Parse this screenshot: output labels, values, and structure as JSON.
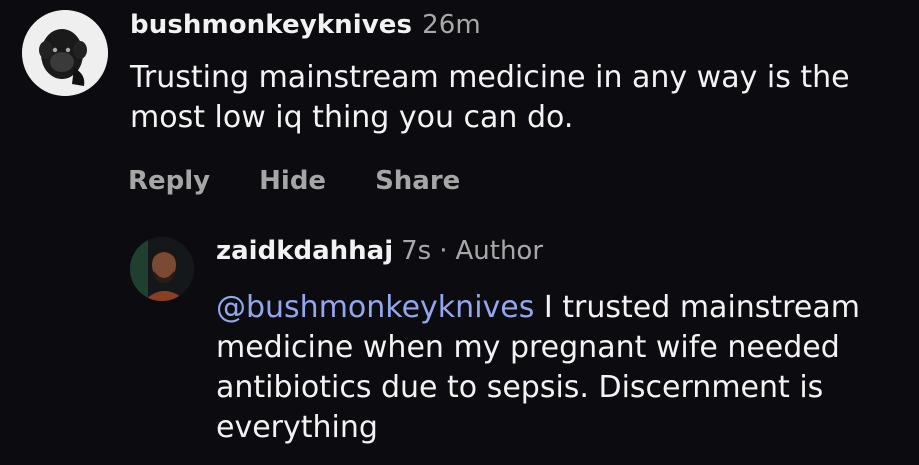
{
  "comments": [
    {
      "username": "bushmonkeyknives",
      "time": "26m",
      "text": "Trusting mainstream medicine in any way is the most low iq thing you can do.",
      "actions": [
        "Reply",
        "Hide",
        "Share"
      ]
    },
    {
      "username": "zaidkdahhaj",
      "time": "7s",
      "separator": "·",
      "role": "Author",
      "mention": "@bushmonkeyknives",
      "text": " I trusted mainstream medicine when my pregnant wife needed antibiotics due to sepsis. Discernment is everything"
    }
  ],
  "colors": {
    "background": "#0c0b10",
    "text": "#f3f3f3",
    "muted": "#a6a6a6",
    "mention": "#93a7ee"
  }
}
